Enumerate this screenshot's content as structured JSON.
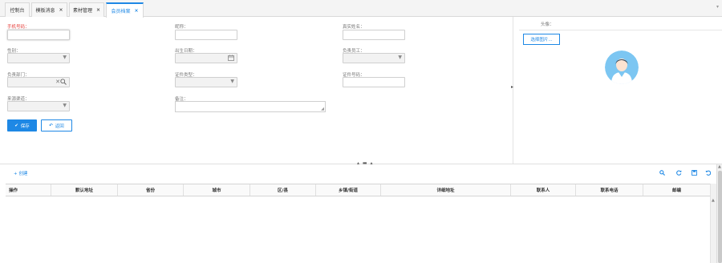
{
  "tabs": [
    {
      "label": "控制台",
      "closable": false,
      "active": false
    },
    {
      "label": "模板消息",
      "closable": true,
      "active": false
    },
    {
      "label": "素材管理",
      "closable": true,
      "active": false
    },
    {
      "label": "会员档案",
      "closable": true,
      "active": true
    }
  ],
  "tab_close_glyph": "×",
  "form": {
    "phone_label": "手机号码：",
    "nickname_label": "昵称：",
    "realname_label": "真实姓名：",
    "gender_label": "性别：",
    "birthday_label": "出生日期：",
    "staff_label": "负责员工：",
    "dept_label": "负责部门：",
    "id_type_label": "证件类型：",
    "id_number_label": "证件号码：",
    "source_label": "来源渠道：",
    "remark_label": "备注："
  },
  "buttons": {
    "save": "保存",
    "back": "返回",
    "choose_image": "选择图片..."
  },
  "avatar": {
    "label": "头像："
  },
  "grid": {
    "create": "+ 创建",
    "columns": [
      "操作",
      "默认地址",
      "省份",
      "城市",
      "区/县",
      "乡镇/街道",
      "详细地址",
      "联系人",
      "联系电话",
      "邮编"
    ]
  },
  "colors": {
    "accent": "#1e88e5",
    "required": "#e53935",
    "avatar_bg": "#7cc6f2"
  }
}
